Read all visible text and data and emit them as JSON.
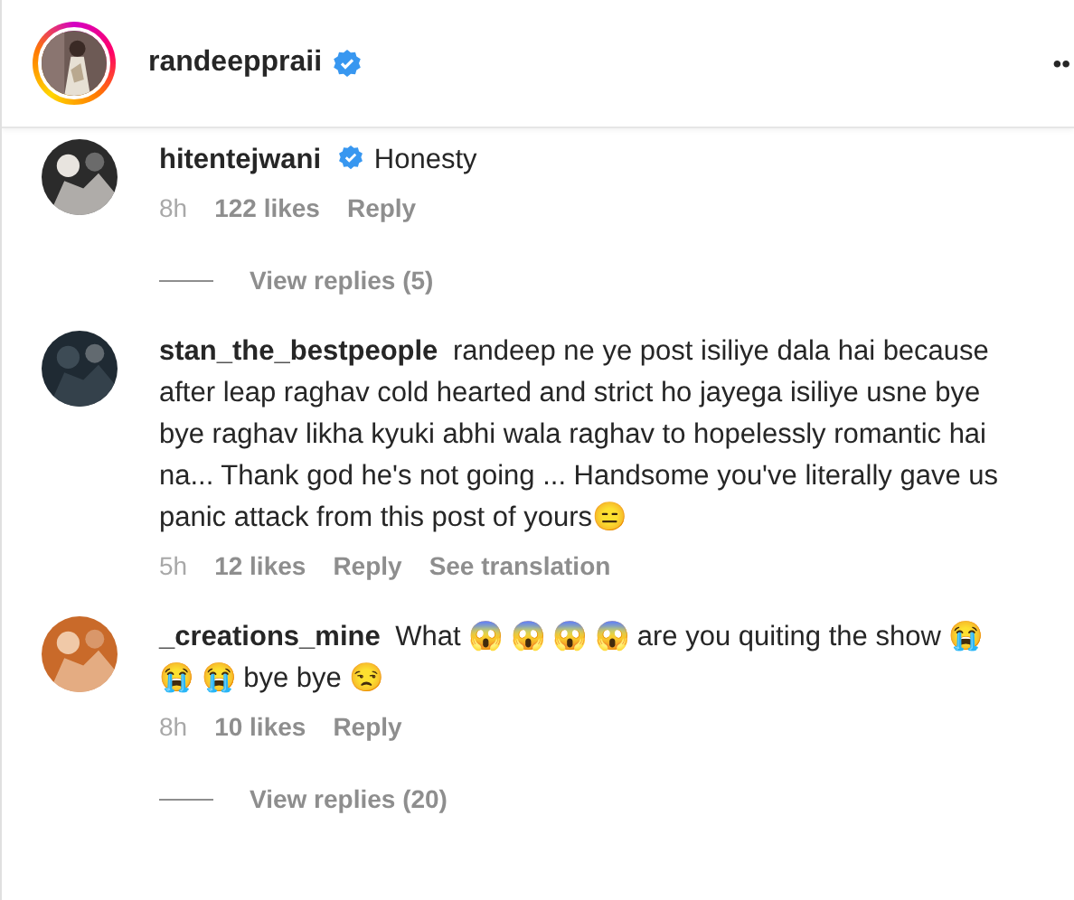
{
  "header": {
    "username": "randeeppraii",
    "verified": true,
    "more": "••"
  },
  "comments": [
    {
      "username": "hitentejwani",
      "verified": true,
      "text": "Honesty",
      "time": "8h",
      "likes": "122 likes",
      "reply": "Reply",
      "view_replies": "View replies (5)"
    },
    {
      "username": "stan_the_bestpeople",
      "verified": false,
      "text": "randeep ne ye post isiliye dala hai because after leap raghav cold hearted and strict ho jayega isiliye usne bye bye raghav likha kyuki abhi wala raghav to hopelessly romantic hai na... Thank god he's not going ... Handsome you've literally gave us panic attack from this post of yours😑",
      "time": "5h",
      "likes": "12 likes",
      "reply": "Reply",
      "translation": "See translation"
    },
    {
      "username": "_creations_mine",
      "verified": false,
      "text": "What 😱 😱 😱 😱  are you quiting the show 😭 😭 😭  bye bye 😒",
      "time": "8h",
      "likes": "10 likes",
      "reply": "Reply",
      "view_replies": "View replies (20)"
    }
  ]
}
